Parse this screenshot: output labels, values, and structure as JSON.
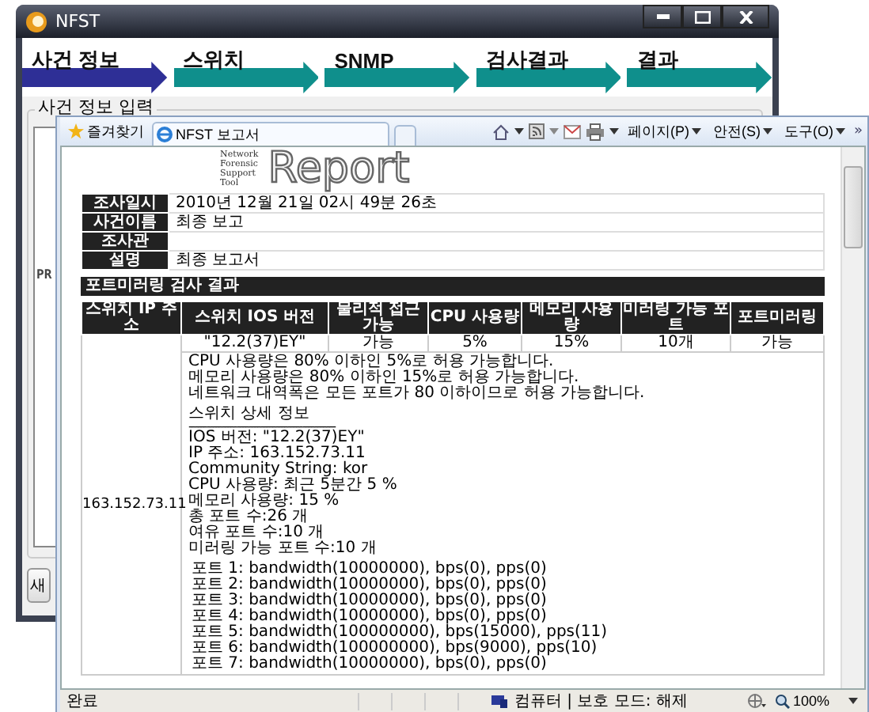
{
  "back_window": {
    "title": "NFST",
    "steps": [
      {
        "label": "사건 정보",
        "selected": true
      },
      {
        "label": "스위치",
        "selected": false
      },
      {
        "label": "SNMP",
        "selected": false
      },
      {
        "label": "검사결과",
        "selected": false
      },
      {
        "label": "결과",
        "selected": false
      }
    ],
    "group_title": "사건 정보 입력",
    "side_label": "PR",
    "button": "새"
  },
  "browser": {
    "favorites": "즐겨찾기",
    "tab": "NFST 보고서",
    "menus": [
      "페이지(P)",
      "안전(S)",
      "도구(O)"
    ],
    "more": "»",
    "report": {
      "logo_words": [
        "Network",
        "Forensic",
        "Support",
        "Tool"
      ],
      "title": "Report",
      "info": [
        {
          "label": "조사일시",
          "value": "2010년 12월 21일 02시 49분 26초"
        },
        {
          "label": "사건이름",
          "value": "최종 보고"
        },
        {
          "label": "조사관"
        },
        {
          "label": "설명",
          "value": "최종 보고서"
        }
      ],
      "section": "포트미러링 검사 결과",
      "columns": [
        "스위치 IP 주소",
        "스위치 IOS 버전",
        "물리적 접근가능",
        "CPU 사용량",
        "메모리 사용량",
        "미러링 가능 포트",
        "포트미러링"
      ],
      "ip": "163.152.73.11",
      "cells": [
        "\"12.2(37)EY\"",
        "가능",
        "5%",
        "15%",
        "10개",
        "가능"
      ],
      "summary": [
        "CPU 사용량은 80% 이하인 5%로 허용 가능합니다.",
        "메모리 사용량은 80% 이하인 15%로 허용 가능합니다.",
        "네트워크 대역폭은 모든 포트가 80 이하이므로 허용 가능합니다."
      ],
      "detail_title": "스위치 상세 정보",
      "divider": "-------------------------------------------------",
      "details": [
        "IOS 버전: \"12.2(37)EY\"",
        "IP 주소: 163.152.73.11",
        "Community String: kor",
        "CPU 사용량: 최근 5분간 5 %",
        "메모리 사용량: 15 %",
        "총 포트 수:26 개",
        "여유 포트 수:10 개",
        "미러링 가능 포트 수:10 개"
      ],
      "ports": [
        "포트 1: bandwidth(10000000), bps(0), pps(0)",
        "포트 2: bandwidth(10000000), bps(0), pps(0)",
        "포트 3: bandwidth(10000000), bps(0), pps(0)",
        "포트 4: bandwidth(10000000), bps(0), pps(0)",
        "포트 5: bandwidth(100000000), bps(15000), pps(11)",
        "포트 6: bandwidth(100000000), bps(9000), pps(10)",
        "포트 7: bandwidth(10000000), bps(0), pps(0)"
      ]
    },
    "status": {
      "text": "완료",
      "zone": "컴퓨터 | 보호 모드: 해제",
      "zoom": "100%"
    }
  }
}
